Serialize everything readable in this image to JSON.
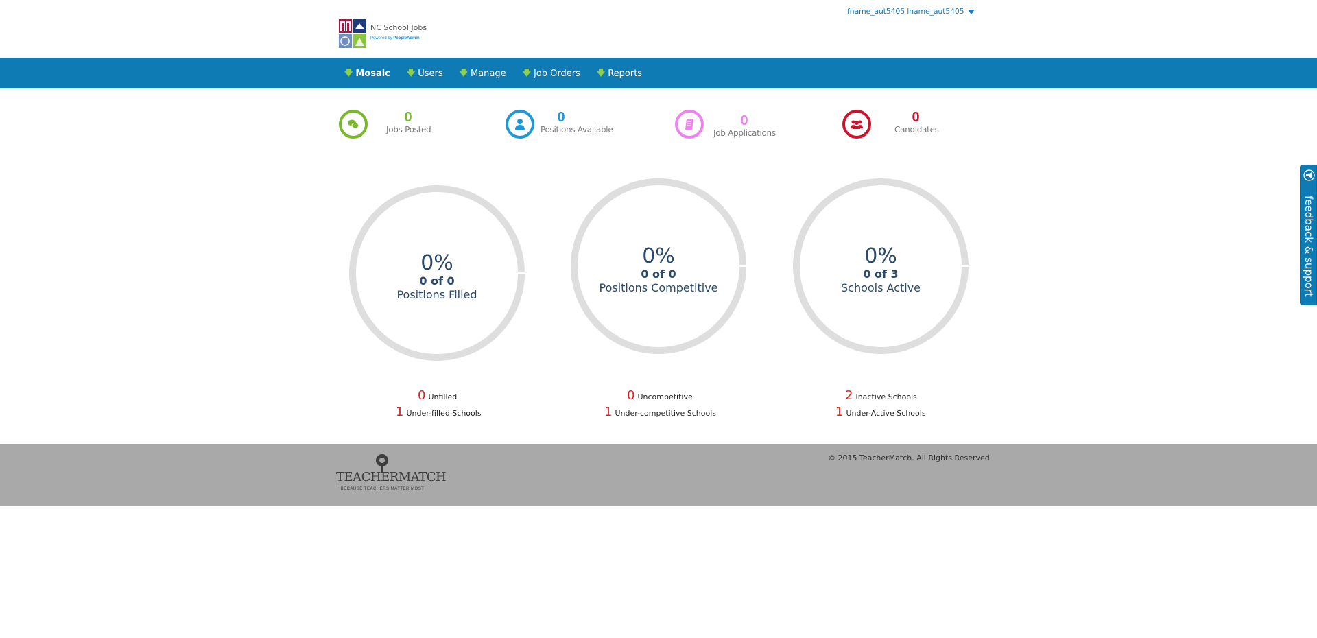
{
  "header": {
    "logo_title": "NC School Jobs",
    "logo_powered": "Powered by",
    "logo_brand": "PeopleAdmin",
    "user_name": "fname_aut5405 lname_aut5405"
  },
  "nav": {
    "items": [
      {
        "label": "Mosaic",
        "active": true
      },
      {
        "label": "Users"
      },
      {
        "label": "Manage"
      },
      {
        "label": "Job Orders"
      },
      {
        "label": "Reports"
      }
    ]
  },
  "stats": [
    {
      "value": "0",
      "label": "Jobs Posted",
      "color": "#79b829",
      "icon": "chat-bubbles-icon"
    },
    {
      "value": "0",
      "label": "Positions Available",
      "color": "#1d9ad6",
      "icon": "person-icon"
    },
    {
      "value": "0",
      "label": "Job Applications",
      "color": "#ee82ee",
      "icon": "document-icon"
    },
    {
      "value": "0",
      "label": "Candidates",
      "color": "#d0112b",
      "icon": "group-icon"
    }
  ],
  "donuts": [
    {
      "percent": "0%",
      "count": "0 of 0",
      "label": "Positions Filled",
      "fill": 0
    },
    {
      "percent": "0%",
      "count": "0 of 0",
      "label": "Positions Competitive",
      "fill": 0
    },
    {
      "percent": "0%",
      "count": "0 of 3",
      "label": "Schools Active",
      "fill": 0
    }
  ],
  "substats": [
    [
      {
        "num": "0",
        "label": "Unfilled"
      },
      {
        "num": "1",
        "label": "Under-filled Schools"
      }
    ],
    [
      {
        "num": "0",
        "label": "Uncompetitive"
      },
      {
        "num": "1",
        "label": "Under-competitive Schools"
      }
    ],
    [
      {
        "num": "2",
        "label": "Inactive Schools"
      },
      {
        "num": "1",
        "label": "Under-Active Schools"
      }
    ]
  ],
  "footer": {
    "brand": "TEACHERMATCH",
    "tagline": "BECAUSE TEACHERS MATTER MOST",
    "copyright": "© 2015 TeacherMatch. All Rights Reserved"
  },
  "feedback": {
    "label": "feedback & support"
  },
  "colors": {
    "nav_bg": "#0f7bb5",
    "ring": "#dedede",
    "footer_bg": "#a9a9a9",
    "accent_red": "#e21b1b"
  }
}
